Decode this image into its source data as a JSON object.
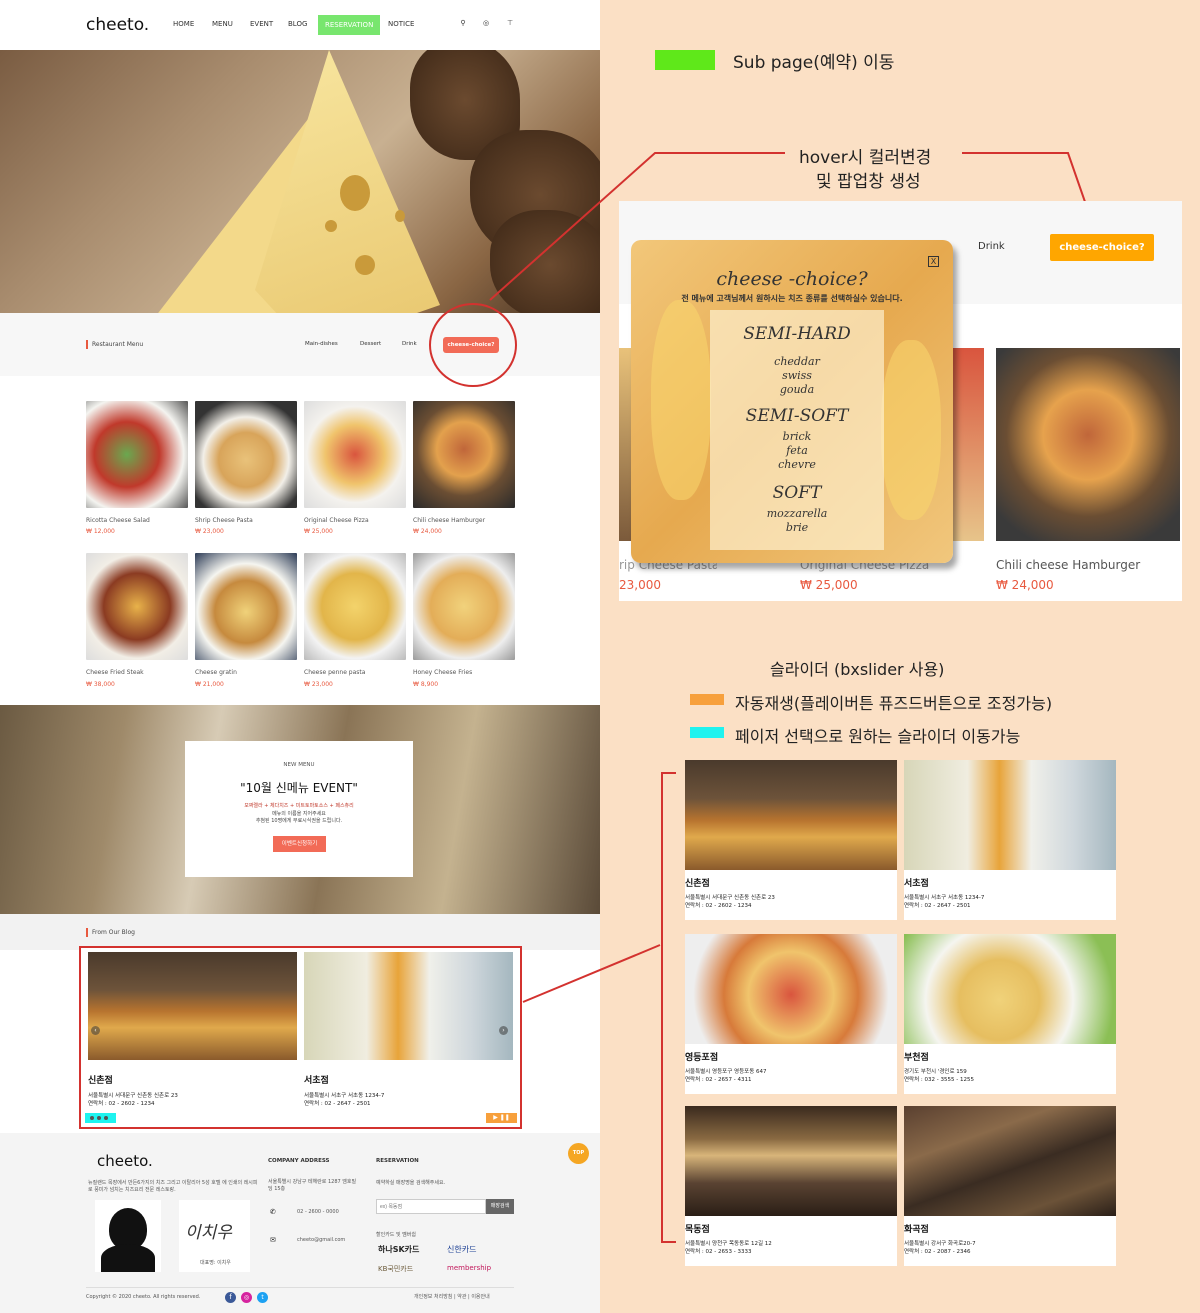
{
  "site": {
    "logo": "cheeto.",
    "nav": [
      "HOME",
      "MENU",
      "EVENT",
      "BLOG",
      "RESERVATION",
      "NOTICE"
    ],
    "colors": {
      "accent": "#e8593f",
      "reservation": "#78e66e",
      "choice": "#f26b57",
      "annotation": "#d3322f"
    },
    "menu_section": {
      "title": "Restaurant Menu",
      "tabs": [
        "Main-dishes",
        "Dessert",
        "Drink"
      ],
      "choice_button": "cheese-choice?"
    },
    "menu_items": [
      {
        "name": "Ricotta Cheese Salad",
        "price": "₩ 12,000"
      },
      {
        "name": "Shrip Cheese Pasta",
        "price": "₩ 23,000"
      },
      {
        "name": "Original Cheese Pizza",
        "price": "₩ 25,000"
      },
      {
        "name": "Chili cheese Hamburger",
        "price": "₩ 24,000"
      },
      {
        "name": "Cheese Fried Steak",
        "price": "₩ 38,000"
      },
      {
        "name": "Cheese gratin",
        "price": "₩ 21,000"
      },
      {
        "name": "Cheese penne pasta",
        "price": "₩ 23,000"
      },
      {
        "name": "Honey Cheese Fries",
        "price": "₩ 8,900"
      }
    ],
    "event": {
      "kicker": "NEW MENU",
      "title": "\"10월 신메뉴 EVENT\"",
      "line1": "모짜렐라 + 체다치즈 + 미트토마토소스 + 페스츄리",
      "line2": "메뉴의 이름을 지어주세요",
      "line3": "추첨된 10명에게 무료시식권을 드립니다.",
      "button": "이벤트신청하기"
    },
    "blog": {
      "title": "From Our Blog",
      "slides": [
        {
          "name": "신촌점",
          "addr": "서울특별시 서대문구 신촌동 신촌로 23",
          "tel": "연락처 : 02 - 2602 - 1234"
        },
        {
          "name": "서초점",
          "addr": "서울특별시 서초구 서초동 1234-7",
          "tel": "연락처 : 02 - 2647 - 2501"
        }
      ]
    },
    "footer": {
      "logo": "cheeto.",
      "about": "뉴질랜드 목장에서 만든6가지의 치즈 그리고 이탈리아 5성 호텔 에 인쇄의 레시피로 풍미가 넘치는 치즈요리 전문 레스토랑.",
      "signature": "이치우",
      "ceo": "대표명: 이치우",
      "company_head": "COMPANY ADDRESS",
      "address": "서울특별시 강남구 테헤란로 1287 엠호빌딩 15층",
      "phone": "02 - 2600 - 0000",
      "email": "cheeto@gmail.com",
      "reservation_head": "RESERVATION",
      "reservation_desc": "예약하실 매장명을 검색해주세요.",
      "search_placeholder": "ex) 목동점",
      "search_button": "매장검색",
      "cards_head": "할인카드 및 멤버쉽",
      "cards": [
        "하나SK카드",
        "신한카드",
        "KB국민카드",
        "membership"
      ],
      "copyright": "Copyright © 2020 cheeto. All rights reserved.",
      "links": "개인정보 처리방침 | 약관 | 이용안내",
      "top": "TOP"
    }
  },
  "annotations": {
    "sub_page": "Sub page(예약) 이동",
    "hover_line1": "hover시 컬러변경",
    "hover_line2": "및 팝업창 생성",
    "slider_title": "슬라이더 (bxslider 사용)",
    "autoplay": "자동재생(플레이버튼 퓨즈드버튼으로 조정가능)",
    "pager": "페이저 선택으로 원하는 슬라이더 이동가능",
    "legend_colors": {
      "sub_page": "#5fe81a",
      "autoplay": "#f7a03c",
      "pager": "#1ff3ef"
    }
  },
  "popup_detail": {
    "tab": "Drink",
    "button": "cheese-choice?",
    "close": "X",
    "title": "cheese -choice?",
    "subtitle": "전 메뉴에 고객님께서 원하시는 치즈 종류를 선택하실수 있습니다.",
    "groups": [
      {
        "name": "SEMI-HARD",
        "items": [
          "cheddar",
          "swiss",
          "gouda"
        ]
      },
      {
        "name": "SEMI-SOFT",
        "items": [
          "brick",
          "feta",
          "chevre"
        ]
      },
      {
        "name": "SOFT",
        "items": [
          "mozzarella",
          "brie"
        ]
      }
    ],
    "behind": [
      {
        "name": "rip Cheese Pasta",
        "price": "23,000"
      },
      {
        "name": "Original Cheese Pizza",
        "price": "₩ 25,000"
      },
      {
        "name": "Chili cheese Hamburger",
        "price": "₩ 24,000"
      }
    ]
  },
  "branches": [
    {
      "name": "신촌점",
      "addr": "서울특별시 서대문구 신촌동 신촌로 23",
      "tel": "연락처 : 02 - 2602 - 1234"
    },
    {
      "name": "서초점",
      "addr": "서울특별시 서초구 서초동 1234-7",
      "tel": "연락처 : 02 - 2647 - 2501"
    },
    {
      "name": "영등포점",
      "addr": "서울특별시 영등포구 영등포동 647",
      "tel": "연락처 : 02 - 2657 - 4311"
    },
    {
      "name": "부천점",
      "addr": "경기도 부천시 '경인로 159",
      "tel": "연락처 : 032 - 3555 - 1255"
    },
    {
      "name": "목동점",
      "addr": "서울특별시 양천구 목동동로 12길 12",
      "tel": "연락처 : 02 - 2653 - 3333"
    },
    {
      "name": "화곡점",
      "addr": "서울특별시 강서구 화곡로20-7",
      "tel": "연락처 : 02 - 2087 - 2346"
    }
  ]
}
